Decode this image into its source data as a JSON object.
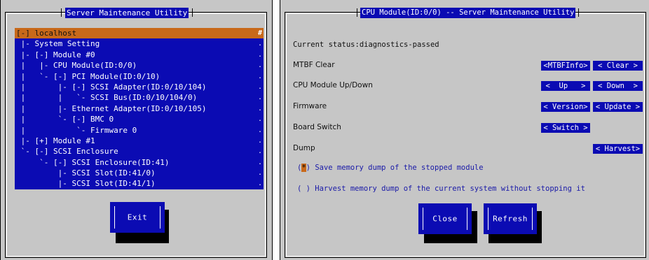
{
  "left": {
    "title": "Server Maintenance Utility",
    "tree": [
      {
        "text": "[-] localhost",
        "marker": "#",
        "selected": true
      },
      {
        "text": " |- System Setting",
        "marker": "."
      },
      {
        "text": " |- [-] Module #0",
        "marker": "."
      },
      {
        "text": " |   |- CPU Module(ID:0/0)",
        "marker": "."
      },
      {
        "text": " |   `- [-] PCI Module(ID:0/10)",
        "marker": "."
      },
      {
        "text": " |       |- [-] SCSI Adapter(ID:0/10/104)",
        "marker": "."
      },
      {
        "text": " |       |   `- SCSI Bus(ID:0/10/104/0)",
        "marker": "."
      },
      {
        "text": " |       |- Ethernet Adapter(ID:0/10/105)",
        "marker": "."
      },
      {
        "text": " |       `- [-] BMC 0",
        "marker": "."
      },
      {
        "text": " |           `- Firmware 0",
        "marker": "."
      },
      {
        "text": " |- [+] Module #1",
        "marker": "."
      },
      {
        "text": " `- [-] SCSI Enclosure",
        "marker": "."
      },
      {
        "text": "     `- [-] SCSI Enclosure(ID:41)",
        "marker": "."
      },
      {
        "text": "         |- SCSI Slot(ID:41/0)",
        "marker": "."
      },
      {
        "text": "         |- SCSI Slot(ID:41/1)",
        "marker": "."
      }
    ],
    "exit_label": "Exit"
  },
  "right": {
    "title": "CPU Module(ID:0/0) -- Server Maintenance Utility",
    "status": "Current status:diagnostics-passed",
    "rows": {
      "mtbf_label": "MTBF Clear",
      "mtbf_info": "<MTBFInfo>",
      "mtbf_clear": "< Clear >",
      "updown_label": "CPU Module Up/Down",
      "up": "<  Up   >",
      "down": "< Down  >",
      "firmware_label": "Firmware",
      "version": "< Version>",
      "update": "< Update >",
      "board_label": "Board Switch",
      "switch": "< Switch >",
      "dump_label": "Dump",
      "harvest": "< Harvest>"
    },
    "radio1_mark": "*",
    "radio1_text": "Save memory dump of the stopped module",
    "radio2_text": "( ) Harvest memory dump of the current system without stopping it",
    "close_label": "Close",
    "refresh_label": "Refresh"
  }
}
